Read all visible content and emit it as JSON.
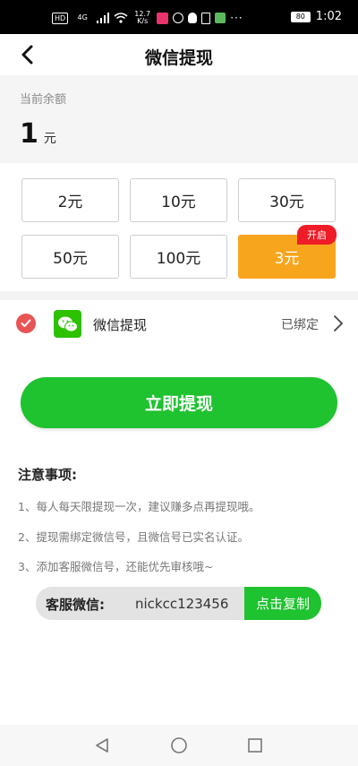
{
  "status_bar": {
    "hd": "HD",
    "net": "4G",
    "speed_value": "12.7",
    "speed_unit": "K/s",
    "more": "···",
    "battery": "80",
    "time": "1:02"
  },
  "header": {
    "title": "微信提现"
  },
  "balance": {
    "label": "当前余额",
    "value": "1",
    "unit": "元"
  },
  "amounts": [
    {
      "label": "2元"
    },
    {
      "label": "10元"
    },
    {
      "label": "30元"
    },
    {
      "label": "50元"
    },
    {
      "label": "100元"
    },
    {
      "label": "3元",
      "badge": "开启",
      "selected": true
    }
  ],
  "method": {
    "label": "微信提现",
    "status": "已绑定",
    "checked": true
  },
  "submit": {
    "label": "立即提现"
  },
  "notes": {
    "title": "注意事项:",
    "items": [
      "1、每人每天限提现一次，建议赚多点再提现哦。",
      "2、提现需绑定微信号，且微信号已实名认证。",
      "3、添加客服微信号，还能优先审核哦~"
    ]
  },
  "customer_service": {
    "label": "客服微信:",
    "id": "nickcc123456",
    "copy_label": "点击复制"
  },
  "colors": {
    "accent_green": "#1fc22f",
    "selected_orange": "#f8a51e",
    "badge_red": "#ee1c26",
    "check_red": "#e85454",
    "wechat_green": "#2dc100"
  },
  "icons": {
    "back": "back-arrow-icon",
    "check": "checkmark-icon",
    "wechat": "wechat-icon",
    "chevron": "chevron-right-icon",
    "nav_back": "triangle-back-icon",
    "nav_home": "circle-home-icon",
    "nav_recents": "square-recents-icon"
  }
}
